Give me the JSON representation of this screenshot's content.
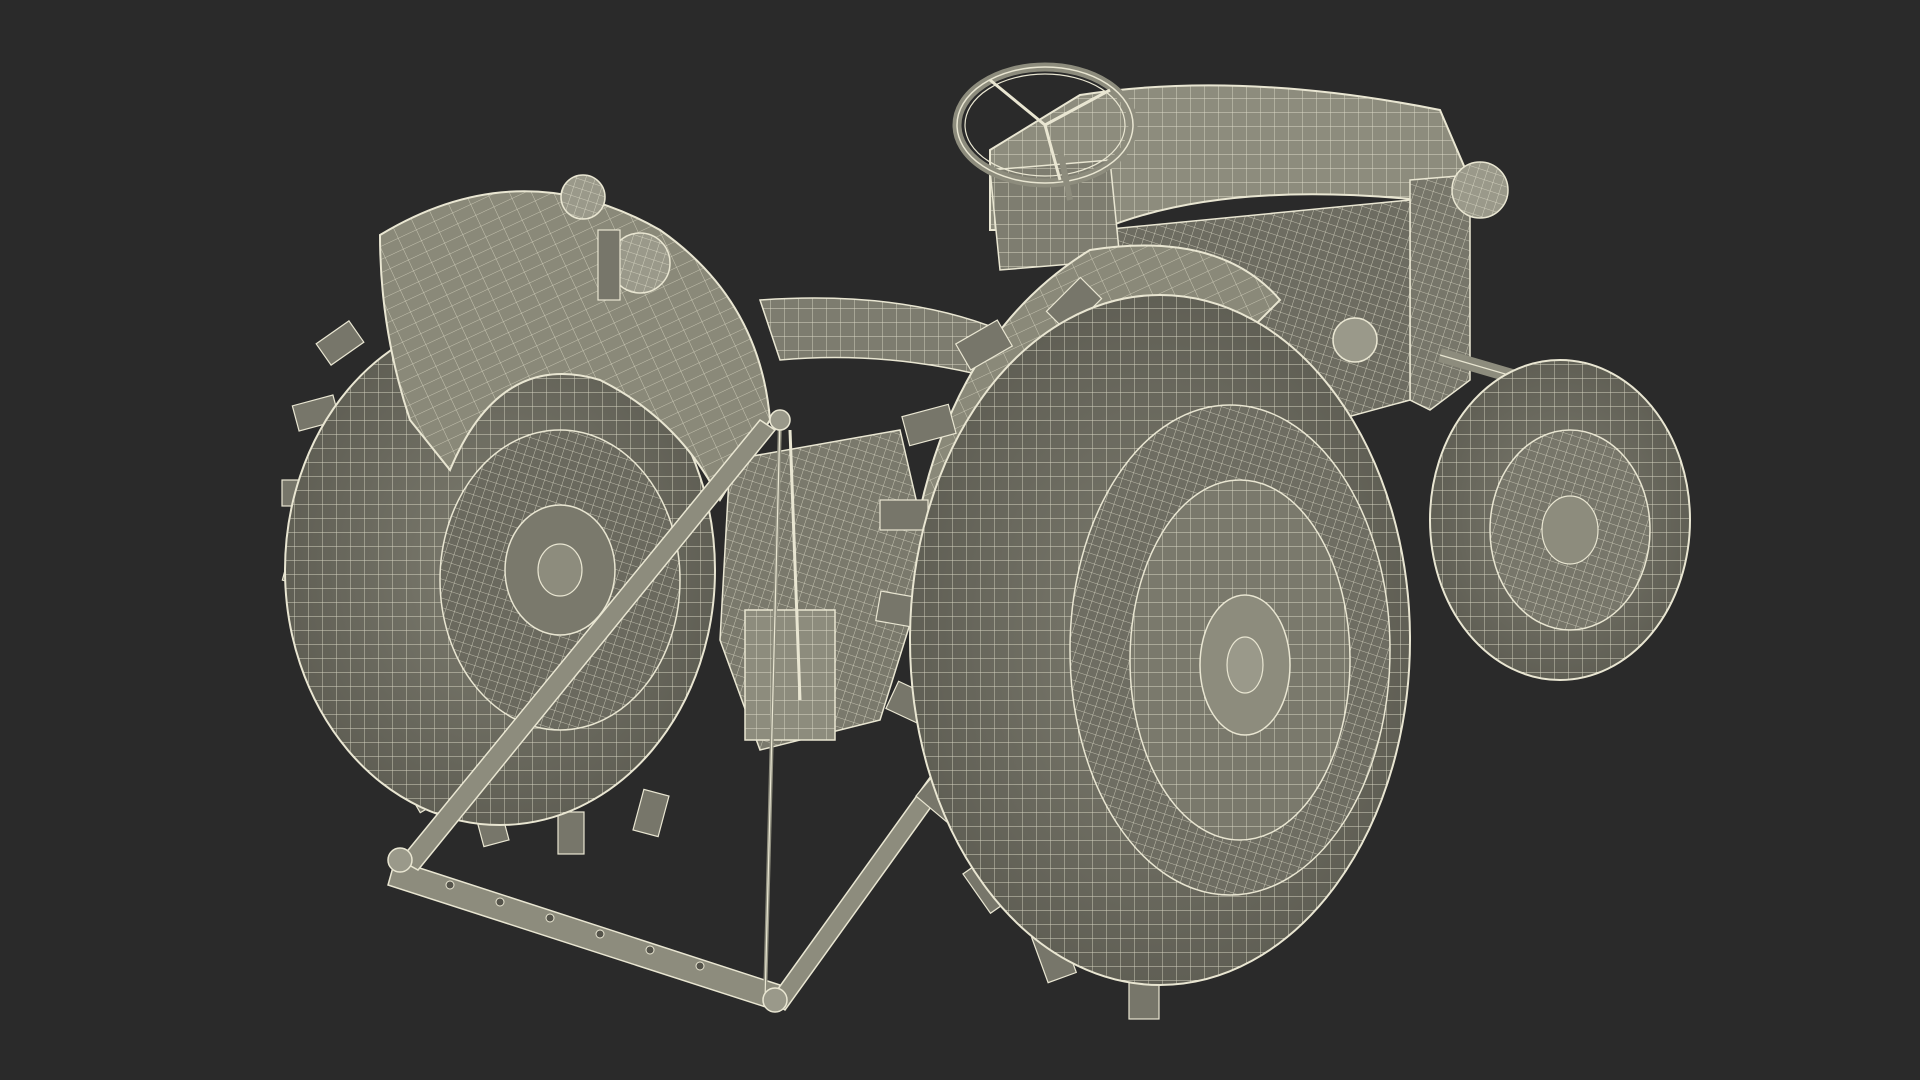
{
  "colors": {
    "background": "#2a2a2a",
    "surface_fill": "#8d8c7d",
    "surface_shade": "#6f6e62",
    "surface_dark": "#55544b",
    "wire": "#e9e6d2"
  },
  "icons": [
    "tractor-wireframe-render"
  ]
}
